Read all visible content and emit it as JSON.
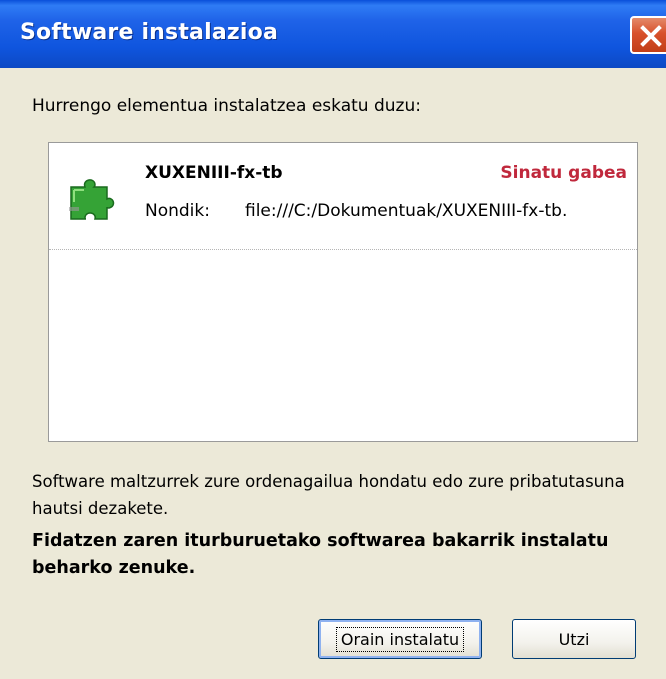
{
  "window": {
    "title": "Software instalazioa"
  },
  "intro_text": "Hurrengo elementua instalatzea eskatu duzu:",
  "item": {
    "name": "XUXENIII-fx-tb",
    "status": "Sinatu gabea",
    "from_label": "Nondik:",
    "from_value": "file:///C:/Dokumentuak/XUXENIII-fx-tb.",
    "icon": "puzzle-piece-icon"
  },
  "warning_text": "Software maltzurrek zure ordenagailua hondatu edo zure pribatutasuna hautsi dezakete.",
  "advice_text": "Fidatzen zaren iturburuetako softwarea bakarrik instalatu beharko zenuke.",
  "buttons": {
    "install_label": "Orain instalatu",
    "cancel_label": "Utzi"
  },
  "colors": {
    "title_bar": "#1f63e8",
    "status_unsigned": "#c0283c",
    "dialog_bg": "#ece9d8",
    "close_button": "#d8512b"
  }
}
